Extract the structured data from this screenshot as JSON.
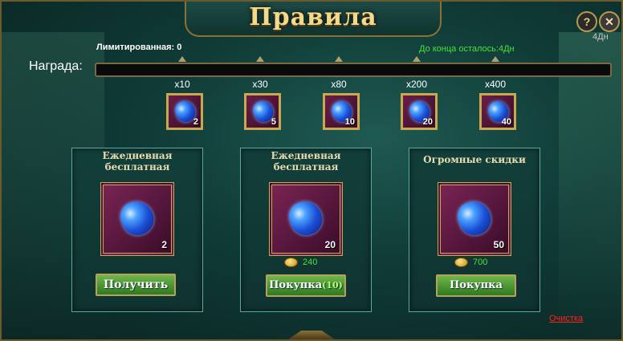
{
  "window": {
    "title": "Правила",
    "help_icon": "?",
    "close_icon": "✕",
    "corner_time": "4Дн"
  },
  "info": {
    "limited_label": "Лимитированная",
    "limited_value": ": 0",
    "time_left": "До конца осталось:4Дн"
  },
  "reward": {
    "label": "Награда:",
    "milestones": [
      {
        "multiplier": "x10",
        "qty": "2"
      },
      {
        "multiplier": "x30",
        "qty": "5"
      },
      {
        "multiplier": "x80",
        "qty": "10"
      },
      {
        "multiplier": "x200",
        "qty": "20"
      },
      {
        "multiplier": "x400",
        "qty": "40"
      }
    ],
    "gem_color": "#1a4fd6"
  },
  "cards": [
    {
      "title": "Ежедневная бесплатная",
      "qty": "2",
      "price": "",
      "button": "Получить",
      "button_count": ""
    },
    {
      "title": "Ежедневная бесплатная",
      "qty": "20",
      "price": "240",
      "button": "Покупка",
      "button_count": "(10)"
    },
    {
      "title": "Огромные скидки",
      "qty": "50",
      "price": "700",
      "button": "Покупка",
      "button_count": ""
    }
  ],
  "footer": {
    "clear_link": "Очистка"
  }
}
